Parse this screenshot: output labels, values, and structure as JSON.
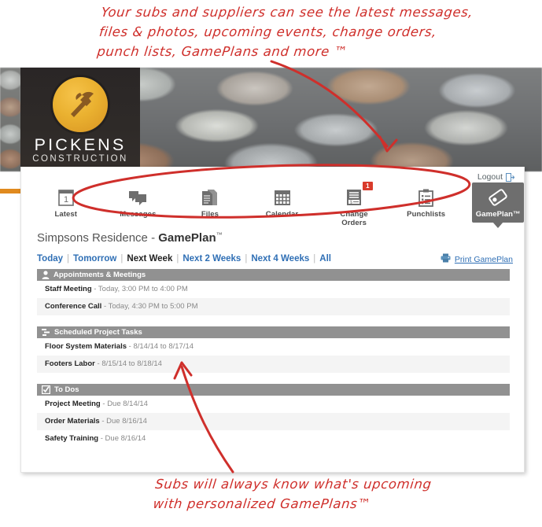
{
  "annotations": {
    "top": [
      "Your subs and suppliers can see the latest messages,",
      "files & photos, upcoming events, change orders,",
      "punch lists, GamePlans and more ™"
    ],
    "bottom": [
      "Subs will always know what's upcoming",
      "with personalized GamePlans™"
    ],
    "color": "#cf2f2b"
  },
  "brand": {
    "name": "PICKENS",
    "sub": "CONSTRUCTION",
    "badge_icon": "hammer-icon",
    "badge_color": "#eab130",
    "accent_color": "#e08a1e"
  },
  "header": {
    "logout_label": "Logout",
    "logout_icon": "logout-icon"
  },
  "nav": {
    "items": [
      {
        "label": "Latest",
        "icon": "calendar-day-icon",
        "active": false,
        "badge": null
      },
      {
        "label": "Messages",
        "icon": "speech-bubbles-icon",
        "active": false,
        "badge": null
      },
      {
        "label": "Files",
        "icon": "documents-icon",
        "active": false,
        "badge": null
      },
      {
        "label": "Calendar",
        "icon": "calendar-grid-icon",
        "active": false,
        "badge": null
      },
      {
        "label": "Change Orders",
        "icon": "invoice-icon",
        "active": false,
        "badge": "1"
      },
      {
        "label": "Punchlists",
        "icon": "clipboard-list-icon",
        "active": false,
        "badge": null
      },
      {
        "label": "GamePlan™",
        "icon": "tag-icon",
        "active": true,
        "badge": null
      }
    ]
  },
  "page": {
    "title_project": "Simpsons Residence - ",
    "title_section": "GamePlan",
    "title_tm": "™"
  },
  "filters": {
    "items": [
      {
        "label": "Today",
        "selected": false
      },
      {
        "label": "Tomorrow",
        "selected": false
      },
      {
        "label": "Next Week",
        "selected": true
      },
      {
        "label": "Next 2 Weeks",
        "selected": false
      },
      {
        "label": "Next 4 Weeks",
        "selected": false
      },
      {
        "label": "All",
        "selected": false
      }
    ],
    "separator": "|"
  },
  "print": {
    "label": "Print GamePlan",
    "icon": "printer-icon"
  },
  "sections": [
    {
      "title": "Appointments & Meetings",
      "icon": "person-icon",
      "rows": [
        {
          "name": "Staff Meeting",
          "detail": " - Today, 3:00 PM to 4:00 PM"
        },
        {
          "name": "Conference Call",
          "detail": " - Today, 4:30 PM to 5:00 PM"
        }
      ]
    },
    {
      "title": "Scheduled Project Tasks",
      "icon": "gantt-icon",
      "rows": [
        {
          "name": "Floor System Materials",
          "detail": " - 8/14/14 to 8/17/14"
        },
        {
          "name": "Footers Labor",
          "detail": " - 8/15/14 to 8/18/14"
        }
      ]
    },
    {
      "title": "To Dos",
      "icon": "checkbox-icon",
      "rows": [
        {
          "name": "Project Meeting",
          "detail": " - Due 8/14/14"
        },
        {
          "name": "Order Materials",
          "detail": " - Due 8/16/14"
        },
        {
          "name": "Safety Training",
          "detail": " - Due 8/16/14"
        }
      ]
    }
  ]
}
